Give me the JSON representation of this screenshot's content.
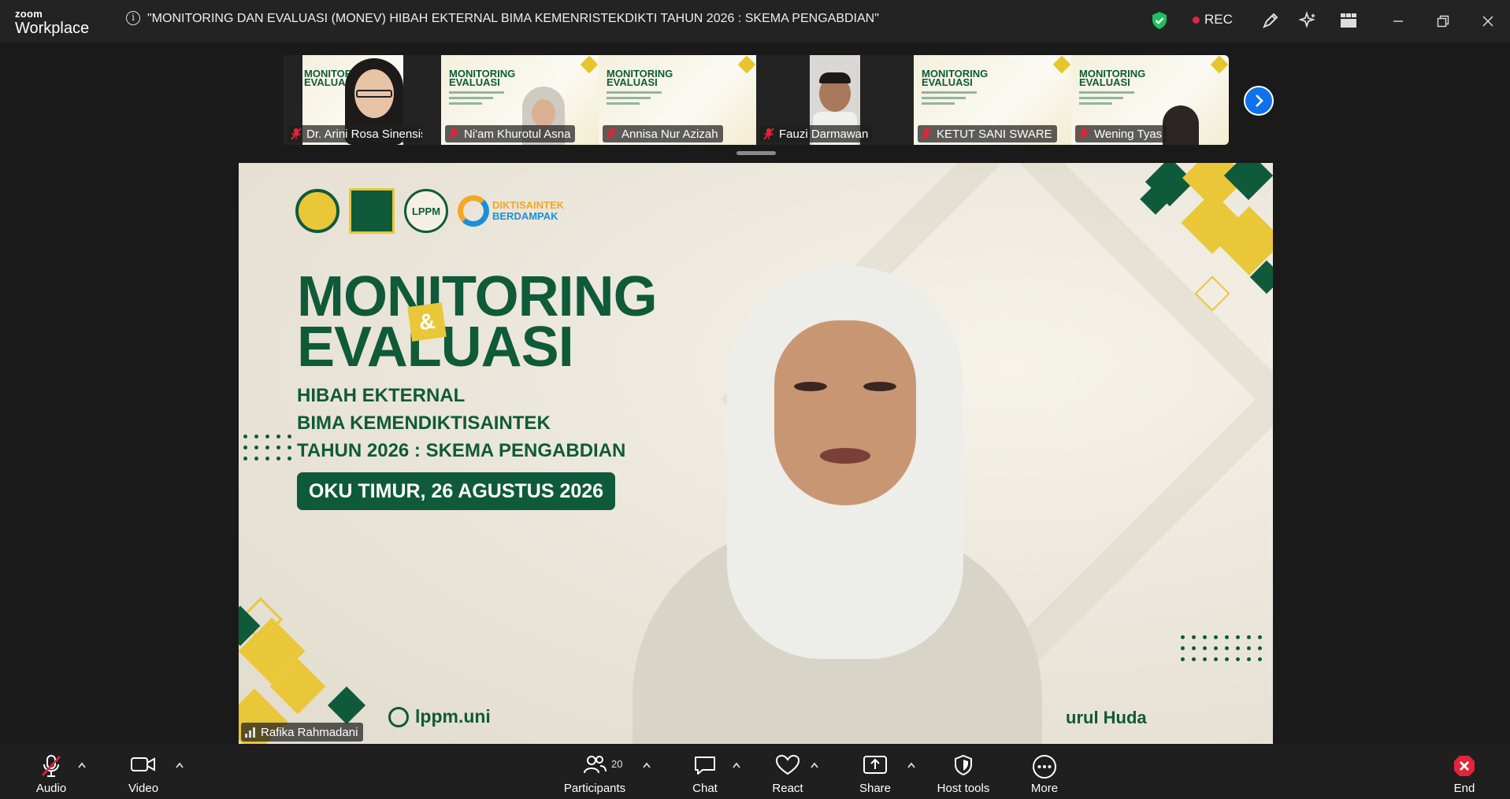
{
  "app": {
    "brand_small": "zoom",
    "brand_main": "Workplace",
    "info_symbol": "i",
    "meeting_title": "\"MONITORING DAN EVALUASI (MONEV) HIBAH EKTERNAL BIMA KEMENRISTEKDIKTI TAHUN 2026 : SKEMA PENGABDIAN\"",
    "rec_label": "REC",
    "icons": [
      "shield-check-icon",
      "pen-annotate-icon",
      "sparkle-ai-icon",
      "gallery-view-icon",
      "minimize-icon",
      "restore-icon",
      "close-icon"
    ]
  },
  "gallery": {
    "participants": [
      {
        "name": "Dr. Arini Rosa Sinensis,...",
        "muted": true
      },
      {
        "name": "Ni'am Khurotul Asna",
        "muted": true
      },
      {
        "name": "Annisa Nur Azizah",
        "muted": true
      },
      {
        "name": "Fauzi Darmawan",
        "muted": true
      },
      {
        "name": "KETUT SANI SWARE",
        "muted": true
      },
      {
        "name": "Wening Tyas",
        "muted": true
      }
    ],
    "mini_slide_title_1": "MONITORING",
    "mini_slide_title_2": "EVALUASI"
  },
  "main_video": {
    "speaker": "Rafika Rahmadani",
    "slide": {
      "title_line1": "MONITORING",
      "title_line2": "EVALUASI",
      "ampersand": "&",
      "sub_line1": "HIBAH EKTERNAL",
      "sub_line2": "BIMA KEMENDIKTISAINTEK",
      "sub_line3": "TAHUN 2026 : SKEMA PENGABDIAN",
      "date": "OKU TIMUR, 26 AGUSTUS 2026",
      "logo_lppm": "LPPM",
      "dikti_line1": "DIKTISAINTEK",
      "dikti_line2": "BERDAMPAK",
      "website": "lppm.uni",
      "footer_right": "urul Huda"
    }
  },
  "toolbar": {
    "audio": "Audio",
    "video": "Video",
    "participants": "Participants",
    "participant_count": "20",
    "chat": "Chat",
    "react": "React",
    "share": "Share",
    "host_tools": "Host tools",
    "more": "More",
    "end": "End"
  },
  "colors": {
    "accent_blue": "#0e72ed",
    "slide_green": "#0f5a3a",
    "slide_yellow": "#e9c739",
    "rec_red": "#e3243b",
    "shield_green": "#1fbf5f"
  }
}
